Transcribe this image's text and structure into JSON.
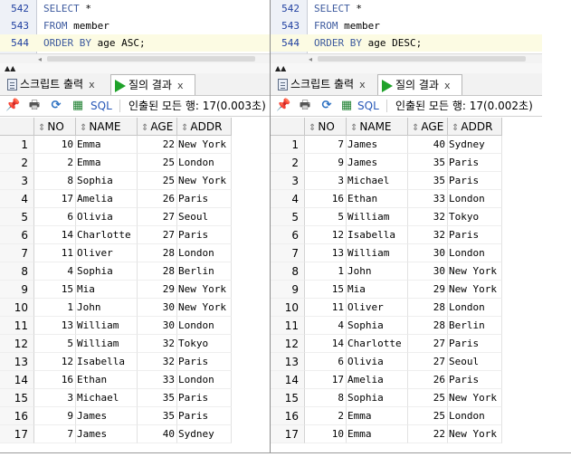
{
  "left": {
    "editor": {
      "lines": [
        {
          "num": "542",
          "kw1": "SELECT",
          "rest": " *"
        },
        {
          "num": "543",
          "kw1": "FROM",
          "rest": " member"
        },
        {
          "num": "544",
          "kw1": "ORDER BY",
          "rest": " age ASC;"
        }
      ]
    },
    "tabs": {
      "script_output": "스크립트 출력",
      "query_result": "질의 결과",
      "close": "x"
    },
    "toolbar": {
      "sql_label": "SQL",
      "status": "인출된 모든 행: 17(0.003초)"
    },
    "columns": [
      "NO",
      "NAME",
      "AGE",
      "ADDR"
    ],
    "rows": [
      [
        "1",
        "10",
        "Emma",
        "22",
        "New York"
      ],
      [
        "2",
        "2",
        "Emma",
        "25",
        "London"
      ],
      [
        "3",
        "8",
        "Sophia",
        "25",
        "New York"
      ],
      [
        "4",
        "17",
        "Amelia",
        "26",
        "Paris"
      ],
      [
        "5",
        "6",
        "Olivia",
        "27",
        "Seoul"
      ],
      [
        "6",
        "14",
        "Charlotte",
        "27",
        "Paris"
      ],
      [
        "7",
        "11",
        "Oliver",
        "28",
        "London"
      ],
      [
        "8",
        "4",
        "Sophia",
        "28",
        "Berlin"
      ],
      [
        "9",
        "15",
        "Mia",
        "29",
        "New York"
      ],
      [
        "10",
        "1",
        "John",
        "30",
        "New York"
      ],
      [
        "11",
        "13",
        "William",
        "30",
        "London"
      ],
      [
        "12",
        "5",
        "William",
        "32",
        "Tokyo"
      ],
      [
        "13",
        "12",
        "Isabella",
        "32",
        "Paris"
      ],
      [
        "14",
        "16",
        "Ethan",
        "33",
        "London"
      ],
      [
        "15",
        "3",
        "Michael",
        "35",
        "Paris"
      ],
      [
        "16",
        "9",
        "James",
        "35",
        "Paris"
      ],
      [
        "17",
        "7",
        "James",
        "40",
        "Sydney"
      ]
    ]
  },
  "right": {
    "editor": {
      "lines": [
        {
          "num": "542",
          "kw1": "SELECT",
          "rest": " *"
        },
        {
          "num": "543",
          "kw1": "FROM",
          "rest": " member"
        },
        {
          "num": "544",
          "kw1": "ORDER BY",
          "rest": " age DESC;"
        }
      ]
    },
    "tabs": {
      "script_output": "스크립트 출력",
      "query_result": "질의 결과",
      "close": "x"
    },
    "toolbar": {
      "sql_label": "SQL",
      "status": "인출된 모든 행: 17(0.002초)"
    },
    "columns": [
      "NO",
      "NAME",
      "AGE",
      "ADDR"
    ],
    "rows": [
      [
        "1",
        "7",
        "James",
        "40",
        "Sydney"
      ],
      [
        "2",
        "9",
        "James",
        "35",
        "Paris"
      ],
      [
        "3",
        "3",
        "Michael",
        "35",
        "Paris"
      ],
      [
        "4",
        "16",
        "Ethan",
        "33",
        "London"
      ],
      [
        "5",
        "5",
        "William",
        "32",
        "Tokyo"
      ],
      [
        "6",
        "12",
        "Isabella",
        "32",
        "Paris"
      ],
      [
        "7",
        "13",
        "William",
        "30",
        "London"
      ],
      [
        "8",
        "1",
        "John",
        "30",
        "New York"
      ],
      [
        "9",
        "15",
        "Mia",
        "29",
        "New York"
      ],
      [
        "10",
        "11",
        "Oliver",
        "28",
        "London"
      ],
      [
        "11",
        "4",
        "Sophia",
        "28",
        "Berlin"
      ],
      [
        "12",
        "14",
        "Charlotte",
        "27",
        "Paris"
      ],
      [
        "13",
        "6",
        "Olivia",
        "27",
        "Seoul"
      ],
      [
        "14",
        "17",
        "Amelia",
        "26",
        "Paris"
      ],
      [
        "15",
        "8",
        "Sophia",
        "25",
        "New York"
      ],
      [
        "16",
        "2",
        "Emma",
        "25",
        "London"
      ],
      [
        "17",
        "10",
        "Emma",
        "22",
        "New York"
      ]
    ]
  },
  "icons": {
    "pin": "pin-icon",
    "print": "print-icon",
    "refresh": "refresh-icon",
    "export": "export-icon",
    "sql": "sql-icon"
  }
}
